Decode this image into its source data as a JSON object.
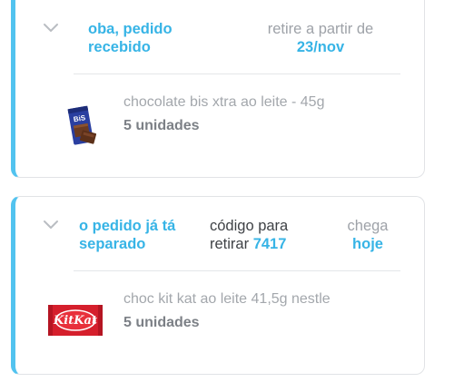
{
  "orders": [
    {
      "status": [
        "oba, pedido",
        "recebido"
      ],
      "pickup": {
        "label": "retire a partir de",
        "date": "23/nov"
      },
      "product": {
        "name": "chocolate bis xtra ao leite - 45g",
        "quantity": "5 unidades",
        "image": "bis-xtra-chocolate-bar",
        "brand_text": "BiS"
      }
    },
    {
      "status": [
        "o pedido já tá",
        "separado"
      ],
      "code": {
        "label_line1": "código para",
        "label_line2": "retirar",
        "value": "7417"
      },
      "arrival": {
        "label": "chega",
        "value": "hoje"
      },
      "product": {
        "name": "choc kit kat ao leite 41,5g nestle",
        "quantity": "5 unidades",
        "image": "kitkat-chocolate-bar",
        "brand_text": "KitKat"
      }
    }
  ],
  "icons": {
    "expand": "chevron-down-icon"
  },
  "colors": {
    "accent": "#37b4e6",
    "card_border_left": "#52c3ef",
    "muted_text": "#9ea2a8",
    "dark_text": "#3f4246",
    "kitkat_red": "#d51f2c",
    "bis_blue": "#2a3fa0"
  }
}
